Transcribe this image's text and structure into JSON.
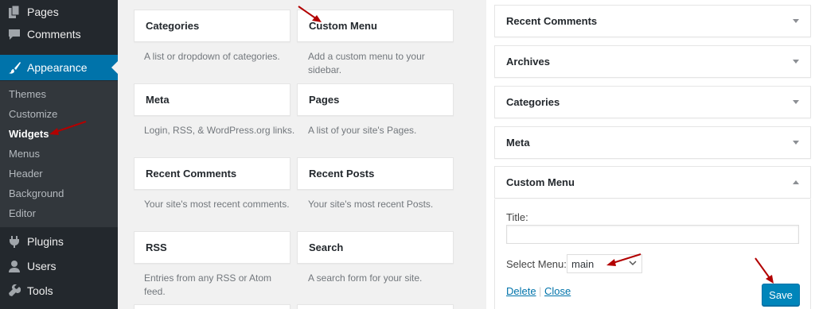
{
  "colors": {
    "sidebar_bg": "#23282d",
    "submenu_bg": "#32373c",
    "active_blue": "#0073aa",
    "button_blue": "#0085ba",
    "annotation_red": "#b20000"
  },
  "sidebar": {
    "menu": [
      {
        "label": "Pages",
        "icon": "pages-icon"
      },
      {
        "label": "Comments",
        "icon": "comments-icon"
      },
      {
        "label": "Appearance",
        "icon": "appearance-brush-icon"
      },
      {
        "label": "Plugins",
        "icon": "plugins-icon"
      },
      {
        "label": "Users",
        "icon": "users-icon"
      },
      {
        "label": "Tools",
        "icon": "tools-icon"
      }
    ],
    "submenu": [
      "Themes",
      "Customize",
      "Widgets",
      "Menus",
      "Header",
      "Background",
      "Editor"
    ],
    "current_submenu": "Widgets"
  },
  "available_widgets": [
    {
      "title": "Categories",
      "desc": "A list or dropdown of categories."
    },
    {
      "title": "Custom Menu",
      "desc": "Add a custom menu to your sidebar."
    },
    {
      "title": "Meta",
      "desc": "Login, RSS, & WordPress.org links."
    },
    {
      "title": "Pages",
      "desc": "A list of your site's Pages."
    },
    {
      "title": "Recent Comments",
      "desc": "Your site's most recent comments."
    },
    {
      "title": "Recent Posts",
      "desc": "Your site's most recent Posts."
    },
    {
      "title": "RSS",
      "desc": "Entries from any RSS or Atom feed."
    },
    {
      "title": "Search",
      "desc": "A search form for your site."
    }
  ],
  "sidebar_area": {
    "widgets": [
      "Recent Comments",
      "Archives",
      "Categories",
      "Meta",
      "Custom Menu"
    ],
    "expanded": {
      "title_label": "Title:",
      "title_value": "",
      "select_label": "Select Menu:",
      "select_value": "main",
      "delete_link": "Delete",
      "separator": "|",
      "close_link": "Close",
      "save_button": "Save"
    }
  }
}
